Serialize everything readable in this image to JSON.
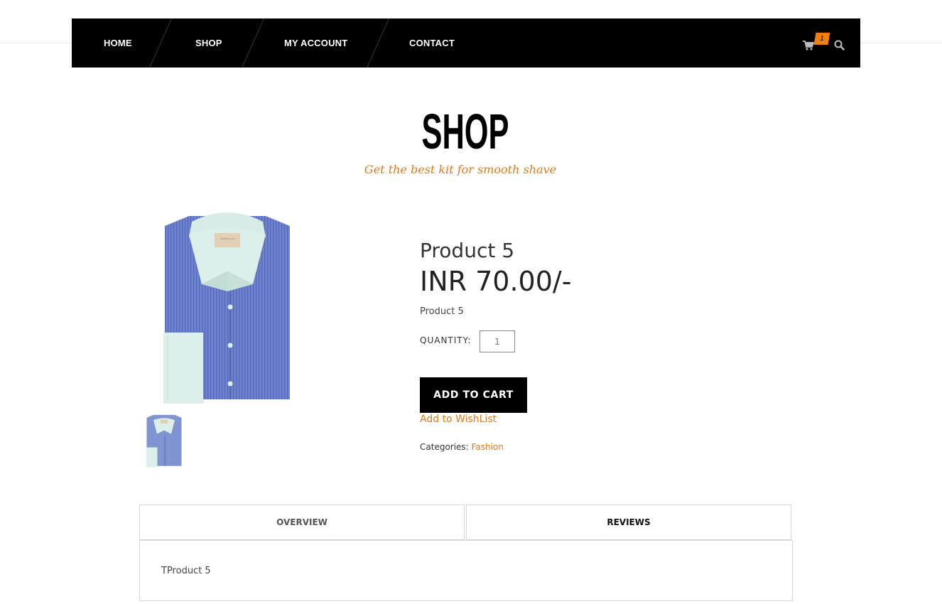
{
  "nav": {
    "items": [
      {
        "label": "HOME"
      },
      {
        "label": "SHOP"
      },
      {
        "label": "MY ACCOUNT"
      },
      {
        "label": "CONTACT"
      }
    ],
    "cart_count": "1",
    "cart_icon": "shopping-cart-icon",
    "search_icon": "search-icon"
  },
  "page": {
    "title": "SHOP",
    "subtitle": "Get the best kit for smooth shave"
  },
  "product": {
    "name": "Product 5",
    "price": "INR 70.00/-",
    "short_description": "Product 5",
    "quantity_label": "QUANTITY:",
    "quantity_value": "1",
    "add_to_cart_label": "ADD TO CART",
    "wishlist_label": "Add to WishList",
    "categories_label": "Categories:",
    "category": "Fashion",
    "image_label": "CARTER & CO."
  },
  "tabs": {
    "items": [
      {
        "label": "OVERVIEW"
      },
      {
        "label": "REVIEWS"
      }
    ],
    "active_content": "TProduct 5"
  },
  "colors": {
    "accent": "#e07b1d",
    "nav_bg": "#000000",
    "badge": "#f07f10"
  }
}
